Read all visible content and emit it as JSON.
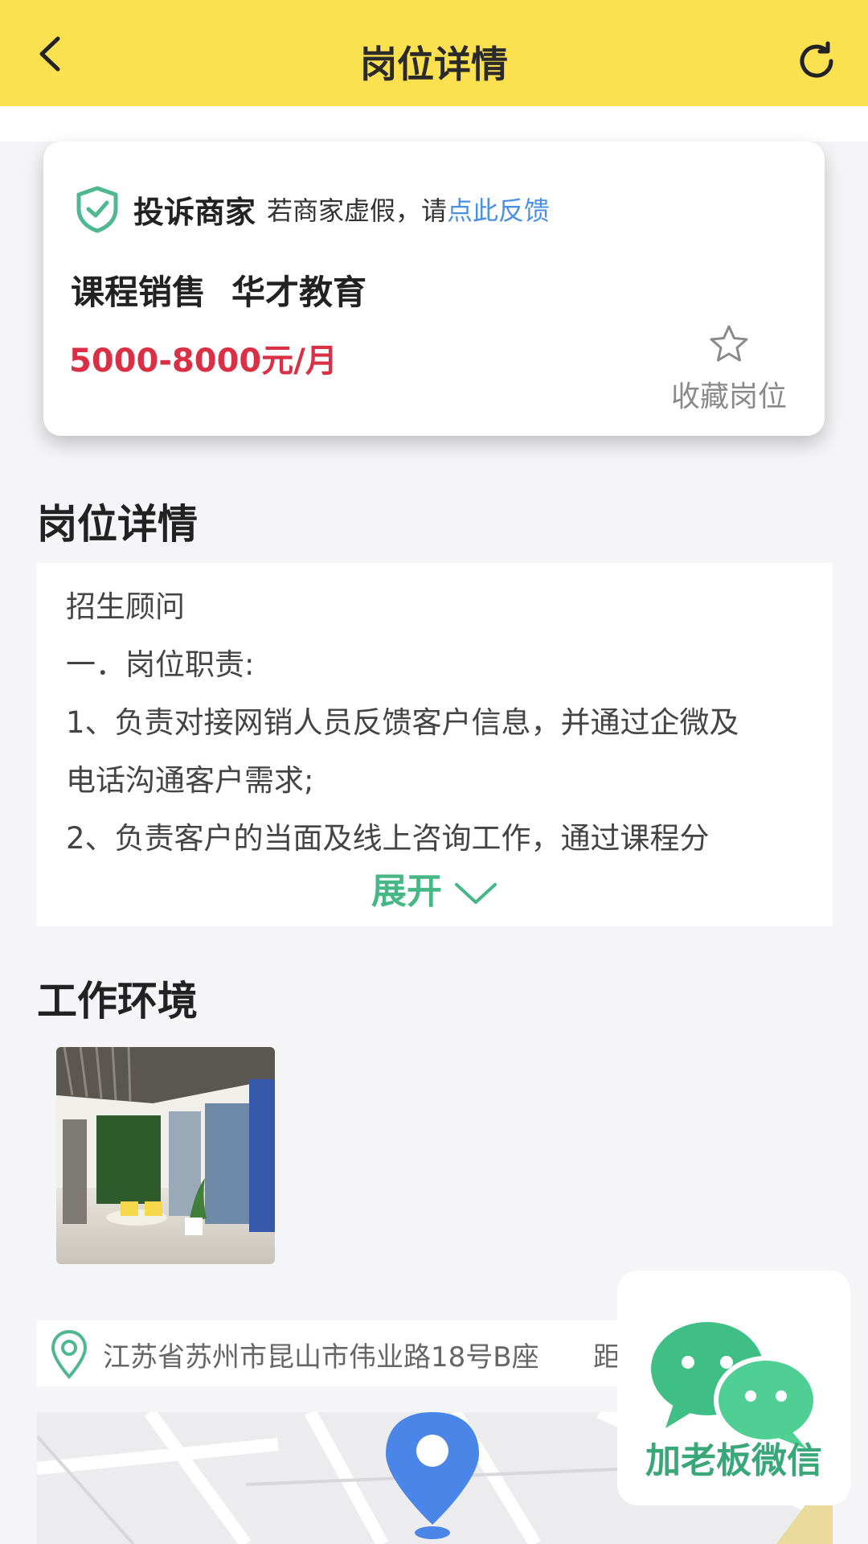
{
  "header": {
    "title": "岗位详情"
  },
  "complaint": {
    "strong": "投诉商家",
    "hint": "若商家虚假，请",
    "link": "点此反馈"
  },
  "job": {
    "position": "课程销售",
    "company": "华才教育",
    "salary": "5000-8000元/月",
    "favorite_label": "收藏岗位"
  },
  "detail": {
    "section_title": "岗位详情",
    "lines": [
      "招生顾问",
      "一．岗位职责:",
      "1、负责对接网销人员反馈客户信息，并通过企微及",
      "电话沟通客户需求;",
      "2、负责客户的当面及线上咨询工作，通过课程分"
    ],
    "expand_label": "展开"
  },
  "environment": {
    "section_title": "工作环境"
  },
  "address": {
    "text": "江苏省苏州市昆山市伟业路18号B座",
    "distance_prefix": "距"
  },
  "wechat": {
    "label": "加老板微信"
  },
  "colors": {
    "header_bg": "#fbe04f",
    "salary": "#d93046",
    "link": "#4a90e2",
    "green": "#46b786"
  }
}
